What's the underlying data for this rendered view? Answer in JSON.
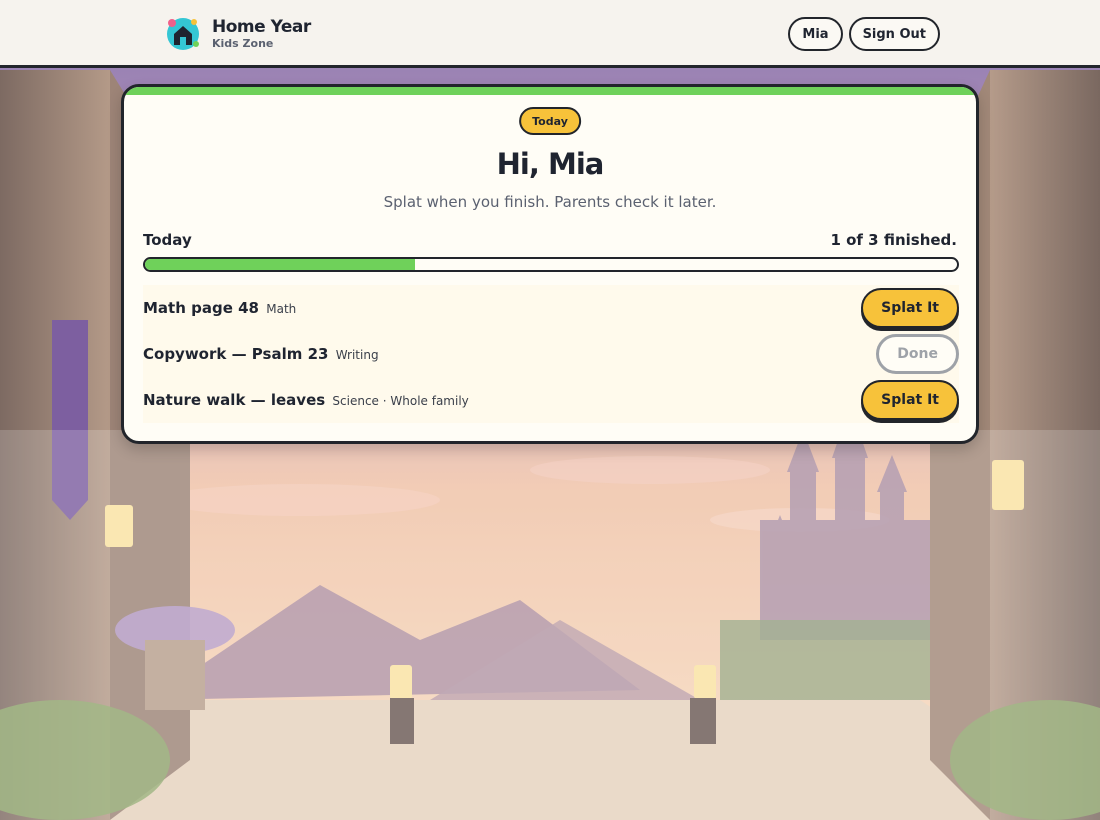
{
  "app": {
    "brand_title": "Home Year",
    "brand_subtitle": "Kids Zone"
  },
  "nav": {
    "user_label": "Mia",
    "sign_out_label": "Sign Out"
  },
  "card": {
    "badge": "Today",
    "greeting": "Hi, Mia",
    "subtitle": "Splat when you finish. Parents check it later.",
    "progress_label": "Today",
    "progress_count_text": "1 of 3 finished.",
    "progress_fraction": 0.333
  },
  "tasks": [
    {
      "title": "Math page 48",
      "meta": "Math",
      "action": "Splat It",
      "status": "todo"
    },
    {
      "title": "Copywork — Psalm 23",
      "meta": "Writing",
      "action": "Done",
      "status": "done"
    },
    {
      "title": "Nature walk — leaves",
      "meta": "Science · Whole family",
      "action": "Splat It",
      "status": "todo"
    }
  ],
  "colors": {
    "accent_green": "#6fd15a",
    "accent_yellow": "#f7c23a",
    "ink": "#22252b"
  },
  "icons": {
    "logo": "house-logo-icon"
  }
}
